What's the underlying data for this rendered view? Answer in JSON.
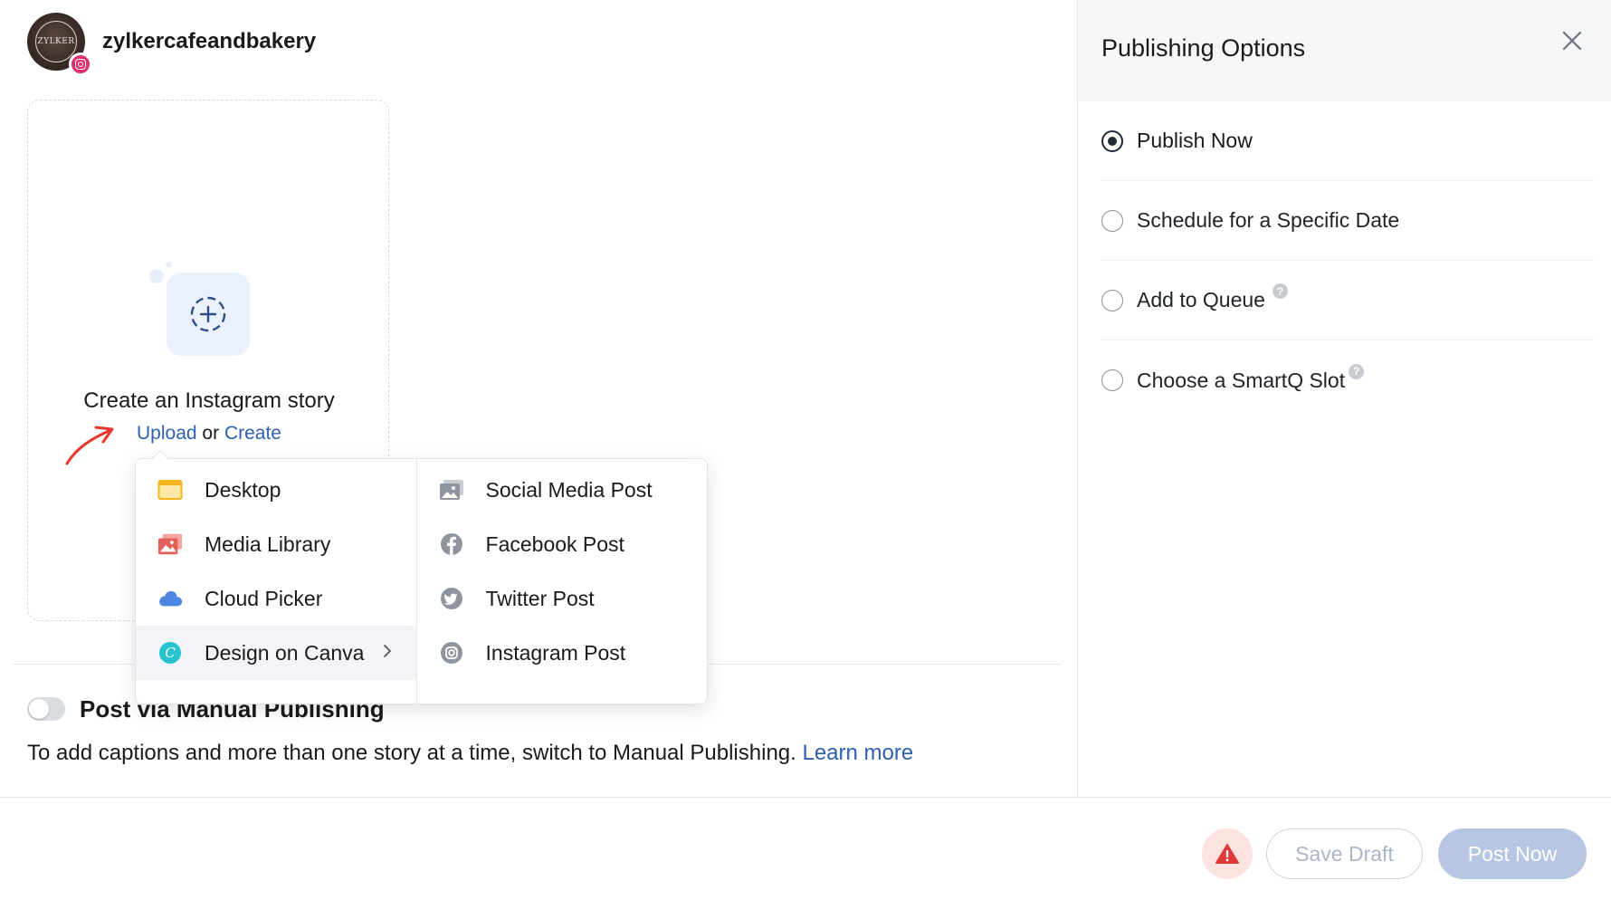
{
  "account": {
    "name": "zylkercafeandbakery",
    "avatar_text": "ZYLKER",
    "network": "instagram-icon"
  },
  "story": {
    "title": "Create an Instagram story",
    "upload_label": "Upload",
    "or_label": "or",
    "create_label": "Create"
  },
  "upload_menu": {
    "left": [
      {
        "label": "Desktop",
        "icon": "desktop-icon"
      },
      {
        "label": "Media Library",
        "icon": "media-library-icon"
      },
      {
        "label": "Cloud Picker",
        "icon": "cloud-icon"
      },
      {
        "label": "Design on Canva",
        "icon": "canva-icon",
        "active": true
      }
    ],
    "right": [
      {
        "label": "Social Media Post",
        "icon": "image-icon"
      },
      {
        "label": "Facebook Post",
        "icon": "facebook-icon"
      },
      {
        "label": "Twitter Post",
        "icon": "twitter-icon"
      },
      {
        "label": "Instagram Post",
        "icon": "instagram-icon"
      }
    ]
  },
  "manual": {
    "title": "Post via Manual Publishing",
    "enabled": false,
    "description": "To add captions and more than one story at a time, switch to Manual Publishing.",
    "learn_more": "Learn more"
  },
  "publishing_options": {
    "title": "Publishing Options",
    "options": [
      {
        "label": "Publish Now",
        "selected": true,
        "help": false
      },
      {
        "label": "Schedule for a Specific Date",
        "selected": false,
        "help": false
      },
      {
        "label": "Add to Queue",
        "selected": false,
        "help": true
      },
      {
        "label": "Choose a SmartQ Slot",
        "selected": false,
        "help": true
      }
    ]
  },
  "footer": {
    "save_draft": "Save Draft",
    "post_now": "Post Now"
  },
  "colors": {
    "link": "#2f5fb3",
    "accent_instagram": "#e1306c",
    "primary_disabled": "#b6c6e3",
    "warning": "#e03b3b"
  }
}
